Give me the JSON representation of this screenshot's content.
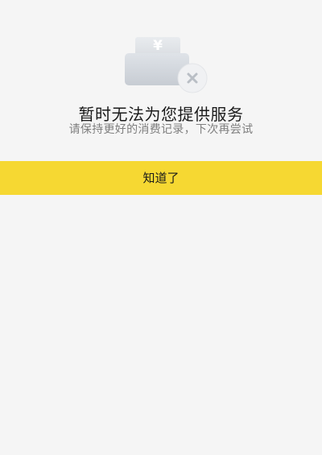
{
  "illustration": {
    "icon": "payment-failed-icon",
    "currency_symbol": "¥"
  },
  "message": {
    "title": "暂时无法为您提供服务",
    "subtitle": "请保持更好的消费记录，下次再尝试"
  },
  "actions": {
    "confirm_label": "知道了"
  },
  "colors": {
    "background": "#f5f5f5",
    "accent": "#f6d832",
    "title_text": "#1a1a1a",
    "subtitle_text": "#7f7f7f"
  }
}
